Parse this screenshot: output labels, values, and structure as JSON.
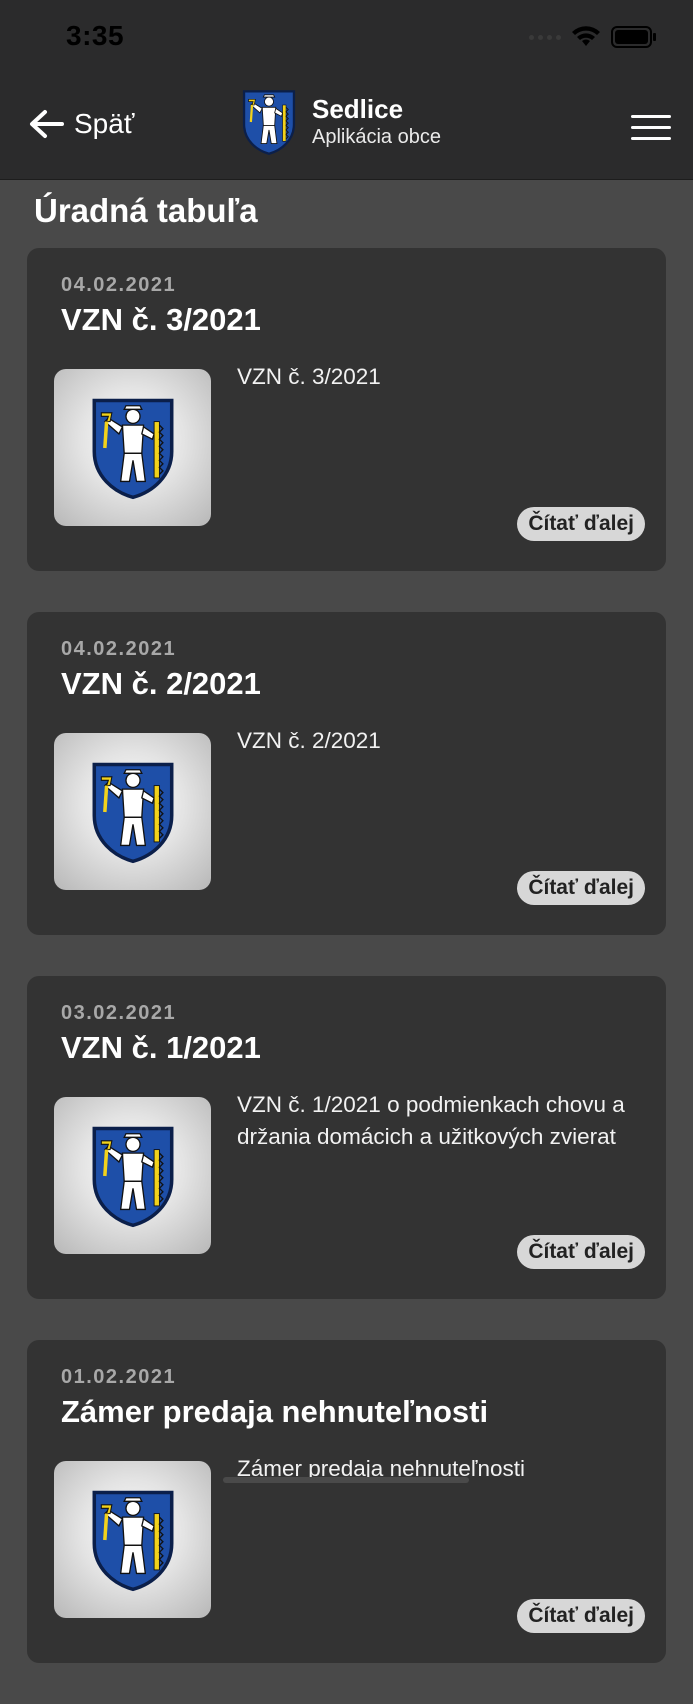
{
  "status": {
    "time": "3:35"
  },
  "nav": {
    "back_label": "Späť",
    "app_title": "Sedlice",
    "app_subtitle": "Aplikácia obce"
  },
  "page": {
    "title": "Úradná tabuľa"
  },
  "cards": [
    {
      "date": "04.02.2021",
      "title": "VZN č. 3/2021",
      "description": "VZN č. 3/2021",
      "button": "Čítať ďalej"
    },
    {
      "date": "04.02.2021",
      "title": "VZN č. 2/2021",
      "description": "VZN č. 2/2021",
      "button": "Čítať ďalej"
    },
    {
      "date": "03.02.2021",
      "title": "VZN č. 1/2021",
      "description": "VZN č. 1/2021 o podmienkach chovu a držania domácich a užitkových zvierat",
      "button": "Čítať ďalej"
    },
    {
      "date": "01.02.2021",
      "title": "Zámer predaja nehnuteľnosti",
      "description": "Zámer predaja nehnuteľnosti",
      "button": "Čítať ďalej"
    }
  ],
  "colors": {
    "background": "#494949",
    "card": "#333333",
    "bar": "#2b2b2c",
    "crest_blue": "#1e4fa8",
    "crest_gold": "#f2d21b"
  }
}
